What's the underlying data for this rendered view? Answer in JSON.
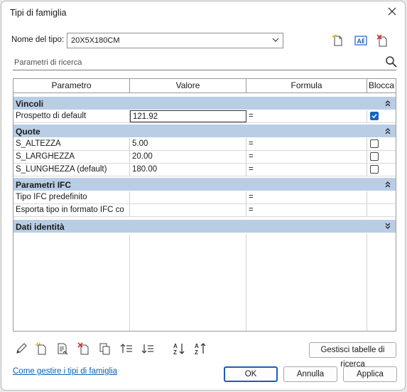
{
  "window": {
    "title": "Tipi di famiglia"
  },
  "type_selector": {
    "label": "Nome del tipo:",
    "value": "20X5X180CM"
  },
  "toolbar_icons": [
    "new-type-icon",
    "rename-type-icon",
    "delete-type-icon"
  ],
  "search": {
    "placeholder": "Parametri di ricerca"
  },
  "grid": {
    "headers": {
      "param": "Parametro",
      "value": "Valore",
      "formula": "Formula",
      "lock": "Blocca"
    },
    "groups": [
      {
        "label": "Vincoli",
        "expanded": true,
        "rows": [
          {
            "param": "Prospetto di default",
            "value": "121.92",
            "formula": "=",
            "lock": true,
            "selected": true
          }
        ]
      },
      {
        "label": "Quote",
        "expanded": true,
        "rows": [
          {
            "param": "S_ALTEZZA",
            "value": "5.00",
            "formula": "=",
            "lock": false
          },
          {
            "param": "S_LARGHEZZA",
            "value": "20.00",
            "formula": "=",
            "lock": false
          },
          {
            "param": "S_LUNGHEZZA (default)",
            "value": "180.00",
            "formula": "=",
            "lock": false
          }
        ]
      },
      {
        "label": "Parametri IFC",
        "expanded": true,
        "rows": [
          {
            "param": "Tipo IFC predefinito",
            "value": "",
            "formula": "=",
            "lock": null
          },
          {
            "param": "Esporta tipo in formato IFC co",
            "value": "",
            "formula": "=",
            "lock": null
          }
        ]
      },
      {
        "label": "Dati identità",
        "expanded": false,
        "rows": []
      }
    ]
  },
  "bottom_toolbar": [
    "edit-pencil-icon",
    "new-parameter-icon",
    "modify-parameter-icon",
    "delete-parameter-icon",
    "copy-icon",
    "move-up-icon",
    "move-down-icon",
    "sort-ascending-icon",
    "sort-descending-icon"
  ],
  "buttons": {
    "lookup": "Gestisci tabelle di ricerca",
    "ok": "OK",
    "cancel": "Annulla",
    "apply": "Applica"
  },
  "help_link": "Come gestire i tipi di famiglia",
  "colors": {
    "group_bg": "#b9cde5",
    "accent": "#1565c0",
    "link": "#0b5fb0"
  }
}
